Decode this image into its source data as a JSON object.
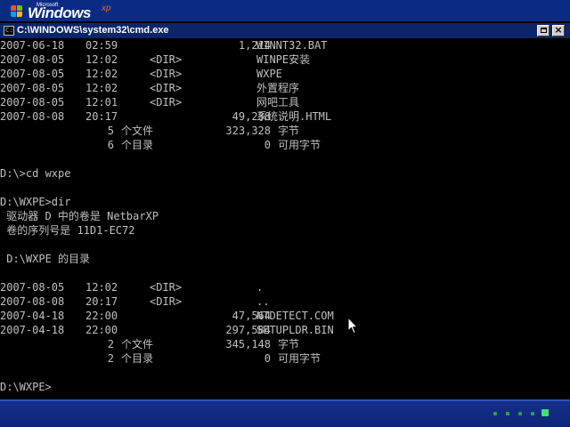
{
  "top_bar": {
    "microsoft_text": "Microsoft",
    "windows_text": "Windows",
    "xp_text": "xp"
  },
  "window": {
    "title": "C:\\WINDOWS\\system32\\cmd.exe",
    "icon_text": "C:\\",
    "restore_icon": "restore-icon",
    "close_label": "×"
  },
  "console": {
    "listing_1": [
      {
        "date": "2007-06-18",
        "time": "02:59",
        "dir": "",
        "size": "1,214",
        "name": "WINNT32.BAT"
      },
      {
        "date": "2007-08-05",
        "time": "12:02",
        "dir": "<DIR>",
        "size": "",
        "name": "WINPE安装"
      },
      {
        "date": "2007-08-05",
        "time": "12:02",
        "dir": "<DIR>",
        "size": "",
        "name": "WXPE"
      },
      {
        "date": "2007-08-05",
        "time": "12:02",
        "dir": "<DIR>",
        "size": "",
        "name": "外置程序"
      },
      {
        "date": "2007-08-05",
        "time": "12:01",
        "dir": "<DIR>",
        "size": "",
        "name": "网吧工具"
      },
      {
        "date": "2007-08-08",
        "time": "20:17",
        "dir": "",
        "size": "49,238",
        "name": "系统说明.HTML"
      }
    ],
    "summary_1": [
      {
        "count": "5",
        "label": "个文件",
        "bytes": "323,328",
        "unit": "字节"
      },
      {
        "count": "6",
        "label": "个目录",
        "bytes": "0",
        "unit": "可用字节"
      }
    ],
    "cmd_cd": "D:\\>cd wxpe",
    "cmd_dir": "D:\\WXPE>dir",
    "volume_line": " 驱动器 D 中的卷是 NetbarXP",
    "serial_line": " 卷的序列号是 11D1-EC72",
    "dir_of_line": " D:\\WXPE 的目录",
    "listing_2": [
      {
        "date": "2007-08-05",
        "time": "12:02",
        "dir": "<DIR>",
        "size": "",
        "name": "."
      },
      {
        "date": "2007-08-08",
        "time": "20:17",
        "dir": "<DIR>",
        "size": "",
        "name": ".."
      },
      {
        "date": "2007-04-18",
        "time": "22:00",
        "dir": "",
        "size": "47,564",
        "name": "NTDETECT.COM"
      },
      {
        "date": "2007-04-18",
        "time": "22:00",
        "dir": "",
        "size": "297,584",
        "name": "SETUPLDR.BIN"
      }
    ],
    "summary_2": [
      {
        "count": "2",
        "label": "个文件",
        "bytes": "345,148",
        "unit": "字节"
      },
      {
        "count": "2",
        "label": "个目录",
        "bytes": "0",
        "unit": "可用字节"
      }
    ],
    "prompt": "D:\\WXPE>"
  },
  "bottom_bar": {
    "progress_dots": 5,
    "active_dot_index": 4,
    "dot_color": "#2fa14a",
    "active_dot_color": "#45e07a"
  },
  "colors": {
    "console_text": "#c0c0c0",
    "console_bg": "#000000",
    "title_bar": "#0b246a",
    "desktop_bar": "#0a2b84",
    "xp_accent": "#e8661a"
  }
}
